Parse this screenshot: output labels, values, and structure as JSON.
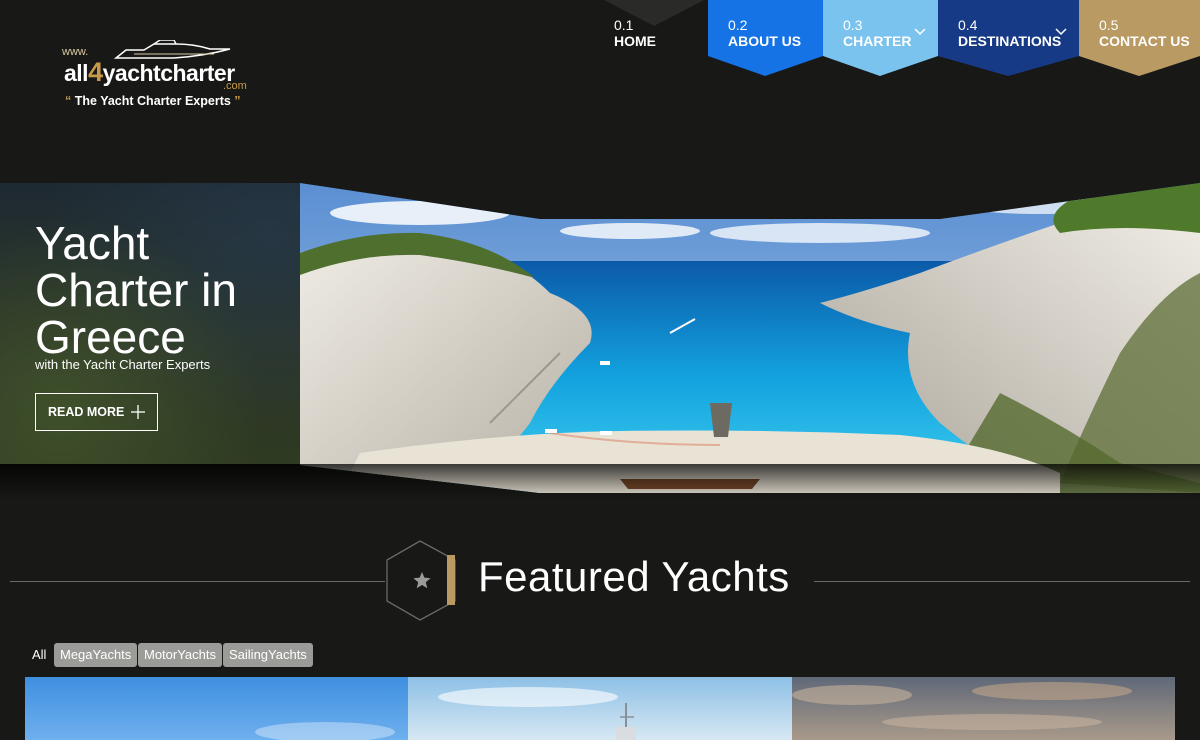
{
  "logo": {
    "www": "www.",
    "brand_pre": "all",
    "brand_four": "4",
    "brand_post": "yachtcharter",
    "com": ".com",
    "tagline": "The Yacht Charter Experts"
  },
  "nav": [
    {
      "num": "0.1",
      "label": "HOME",
      "color": "#2a2a28"
    },
    {
      "num": "0.2",
      "label": "ABOUT US",
      "color": "#1673e6"
    },
    {
      "num": "0.3",
      "label": "CHARTER",
      "color": "#79c3ee",
      "dropdown": true
    },
    {
      "num": "0.4",
      "label": "DESTINATIONS",
      "color": "#173a86",
      "dropdown": true
    },
    {
      "num": "0.5",
      "label": "CONTACT US",
      "color": "#b99a63"
    }
  ],
  "hero": {
    "title": "Yacht Charter in Greece",
    "subtitle": "with the Yacht Charter Experts",
    "cta": "READ MORE"
  },
  "featured": {
    "title": "Featured Yachts",
    "icon": "star-icon"
  },
  "filters": [
    {
      "label": "All",
      "active": true
    },
    {
      "label": "MegaYachts",
      "active": false
    },
    {
      "label": "MotorYachts",
      "active": false
    },
    {
      "label": "SailingYachts",
      "active": false
    }
  ],
  "colors": {
    "background": "#181816",
    "accent_gold": "#b99a63"
  }
}
